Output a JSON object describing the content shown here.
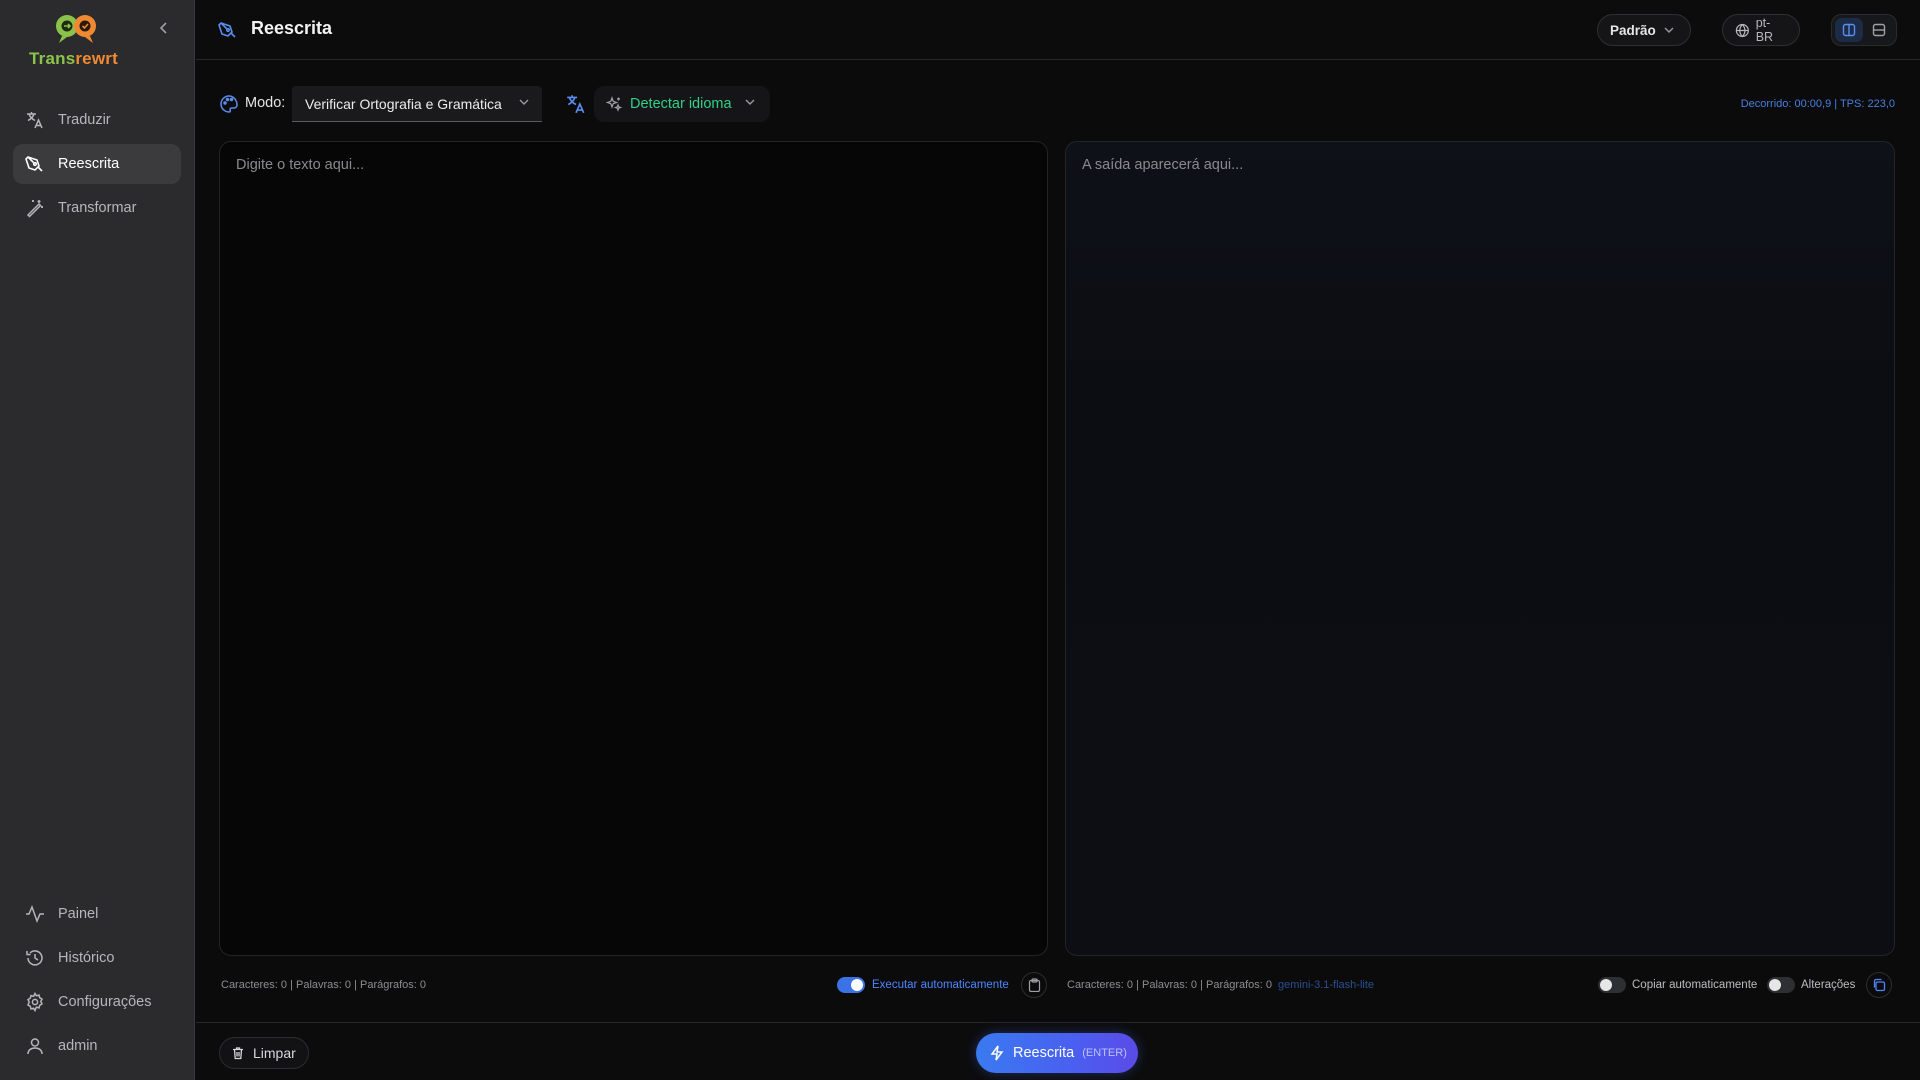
{
  "app": {
    "logo_part1": "Trans",
    "logo_part2": "rewrt",
    "brand_colors": {
      "green": "#8bc34a",
      "orange": "#ef8a33",
      "accent": "#3b73e6"
    }
  },
  "sidebar": {
    "items": [
      {
        "label": "Traduzir",
        "icon": "translate-icon",
        "active": false
      },
      {
        "label": "Reescrita",
        "icon": "pen-icon",
        "active": true
      },
      {
        "label": "Transformar",
        "icon": "magic-wand-icon",
        "active": false
      }
    ],
    "bottom_items": [
      {
        "label": "Painel",
        "icon": "activity-icon"
      },
      {
        "label": "Histórico",
        "icon": "history-icon"
      },
      {
        "label": "Configurações",
        "icon": "gear-icon"
      },
      {
        "label": "admin",
        "icon": "user-icon"
      }
    ]
  },
  "header": {
    "title": "Reescrita",
    "preset": "Padrão",
    "locale": "pt-BR"
  },
  "toolbar": {
    "mode_label": "Modo:",
    "mode_value": "Verificar Ortografia e Gramática",
    "language_value": "Detectar idioma",
    "stats": "Decorrido: 00:00,9 | TPS: 223,0"
  },
  "input_panel": {
    "placeholder": "Digite o texto aqui...",
    "stats": "Caracteres: 0 | Palavras: 0 | Parágrafos: 0",
    "auto_run_label": "Executar automaticamente",
    "auto_run_on": true
  },
  "output_panel": {
    "placeholder": "A saída aparecerá aqui...",
    "stats": "Caracteres: 0 | Palavras: 0 | Parágrafos: 0",
    "model": "gemini-3.1-flash-lite",
    "auto_copy_label": "Copiar automaticamente",
    "auto_copy_on": false,
    "changes_label": "Alterações",
    "changes_on": false
  },
  "bottom_bar": {
    "clear_label": "Limpar",
    "run_label": "Reescrita",
    "run_shortcut": "(ENTER)"
  }
}
